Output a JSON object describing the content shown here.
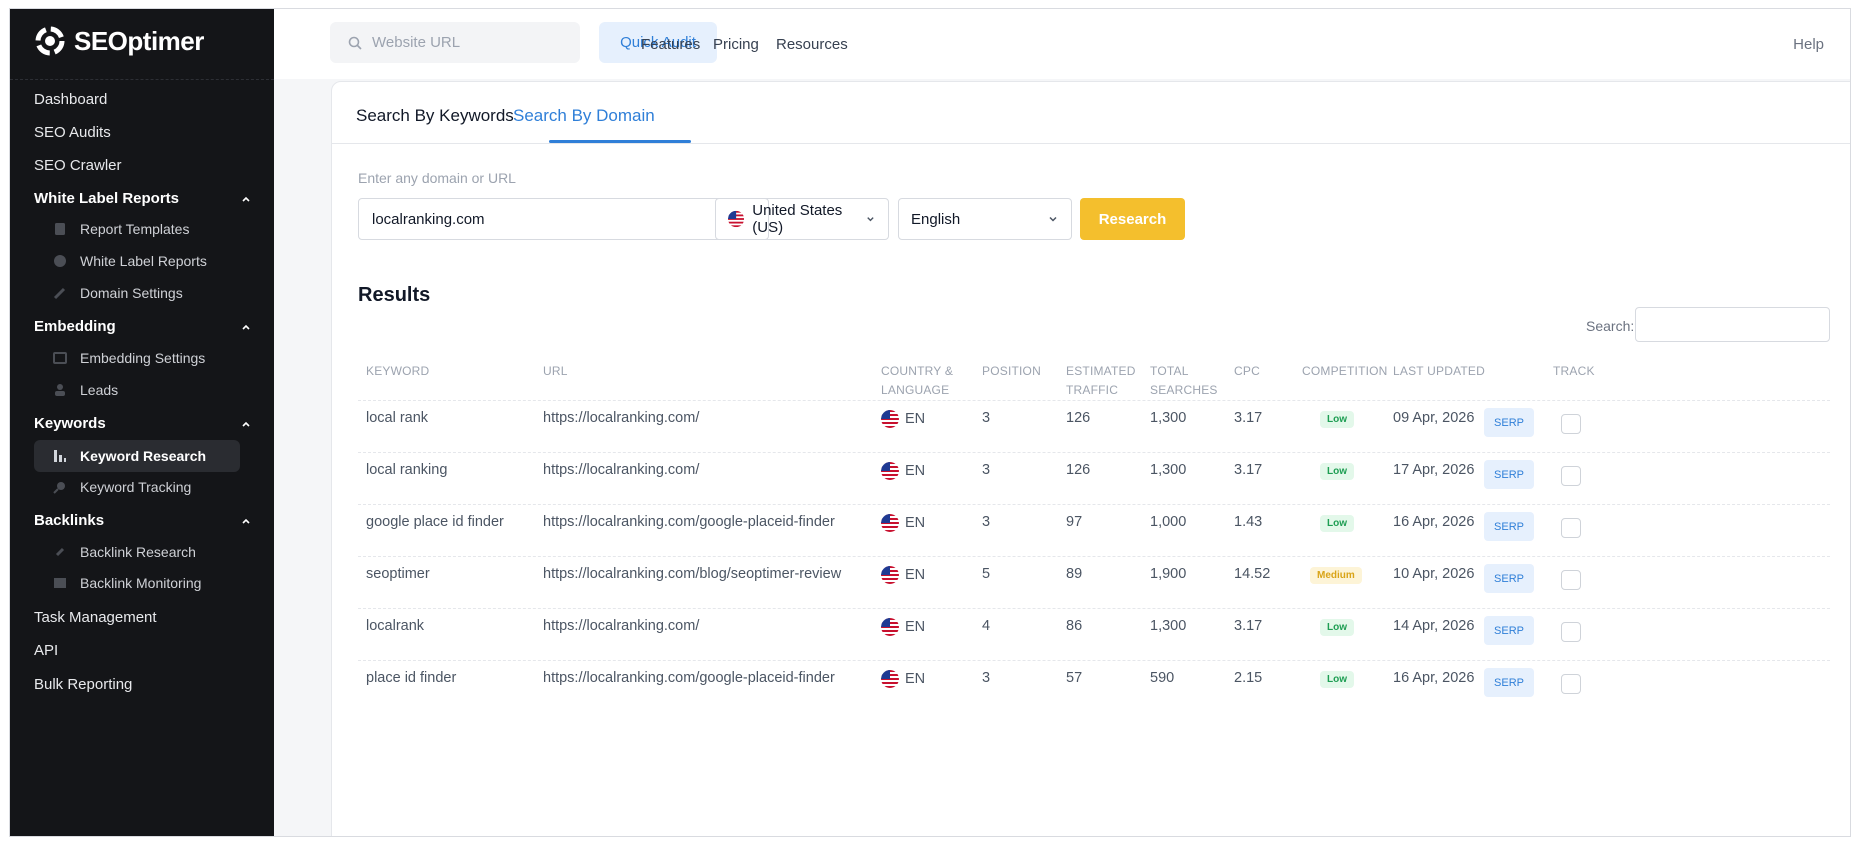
{
  "brand": {
    "name": "SEOptimer"
  },
  "sidebar": {
    "top": [
      {
        "label": "Dashboard"
      },
      {
        "label": "SEO Audits"
      },
      {
        "label": "SEO Crawler"
      }
    ],
    "groups": [
      {
        "label": "White Label Reports",
        "items": [
          {
            "label": "Report Templates",
            "icon": "template-icon"
          },
          {
            "label": "White Label Reports",
            "icon": "report-icon"
          },
          {
            "label": "Domain Settings",
            "icon": "satellite-icon"
          }
        ]
      },
      {
        "label": "Embedding",
        "items": [
          {
            "label": "Embedding Settings",
            "icon": "embed-icon"
          },
          {
            "label": "Leads",
            "icon": "leads-icon"
          }
        ]
      },
      {
        "label": "Keywords",
        "items": [
          {
            "label": "Keyword Research",
            "icon": "bar-chart-icon",
            "active": true
          },
          {
            "label": "Keyword Tracking",
            "icon": "tracking-icon"
          }
        ]
      },
      {
        "label": "Backlinks",
        "items": [
          {
            "label": "Backlink Research",
            "icon": "link-icon"
          },
          {
            "label": "Backlink Monitoring",
            "icon": "monitor-icon"
          }
        ]
      }
    ],
    "bottom": [
      {
        "label": "Task Management"
      },
      {
        "label": "API"
      },
      {
        "label": "Bulk Reporting"
      }
    ]
  },
  "topbar": {
    "search_placeholder": "Website URL",
    "quick_audit": "Quick Audit",
    "nav": [
      "Features",
      "Pricing",
      "Resources"
    ],
    "help": "Help"
  },
  "tabs": [
    {
      "label": "Search By Keywords",
      "active": false
    },
    {
      "label": "Search By Domain",
      "active": true
    }
  ],
  "form": {
    "label": "Enter any domain or URL",
    "domain_value": "localranking.com",
    "country": "United States (US)",
    "language": "English",
    "research_button": "Research"
  },
  "results": {
    "title": "Results",
    "search_label": "Search:",
    "columns": [
      "KEYWORD",
      "URL",
      "COUNTRY &",
      "LANGUAGE",
      "POSITION",
      "ESTIMATED",
      "TRAFFIC",
      "TOTAL",
      "SEARCHES",
      "CPC",
      "COMPETITION",
      "LAST UPDATED",
      "TRACK"
    ],
    "rows": [
      {
        "keyword": "local rank",
        "url": "https://localranking.com/",
        "lang": "EN",
        "position": "3",
        "traffic": "126",
        "searches": "1,300",
        "cpc": "3.17",
        "competition": "Low",
        "updated": "09 Apr, 2026",
        "serp": "SERP"
      },
      {
        "keyword": "local ranking",
        "url": "https://localranking.com/",
        "lang": "EN",
        "position": "3",
        "traffic": "126",
        "searches": "1,300",
        "cpc": "3.17",
        "competition": "Low",
        "updated": "17 Apr, 2026",
        "serp": "SERP"
      },
      {
        "keyword": "google place id finder",
        "url": "https://localranking.com/google-placeid-finder",
        "lang": "EN",
        "position": "3",
        "traffic": "97",
        "searches": "1,000",
        "cpc": "1.43",
        "competition": "Low",
        "updated": "16 Apr, 2026",
        "serp": "SERP"
      },
      {
        "keyword": "seoptimer",
        "url": "https://localranking.com/blog/seoptimer-review",
        "lang": "EN",
        "position": "5",
        "traffic": "89",
        "searches": "1,900",
        "cpc": "14.52",
        "competition": "Medium",
        "updated": "10 Apr, 2026",
        "serp": "SERP"
      },
      {
        "keyword": "localrank",
        "url": "https://localranking.com/",
        "lang": "EN",
        "position": "4",
        "traffic": "86",
        "searches": "1,300",
        "cpc": "3.17",
        "competition": "Low",
        "updated": "14 Apr, 2026",
        "serp": "SERP"
      },
      {
        "keyword": "place id finder",
        "url": "https://localranking.com/google-placeid-finder",
        "lang": "EN",
        "position": "3",
        "traffic": "57",
        "searches": "590",
        "cpc": "2.15",
        "competition": "Low",
        "updated": "16 Apr, 2026",
        "serp": "SERP"
      }
    ]
  },
  "colors": {
    "accent": "#2f7fd8",
    "research": "#f4bf2d",
    "sidebar": "#141518"
  }
}
